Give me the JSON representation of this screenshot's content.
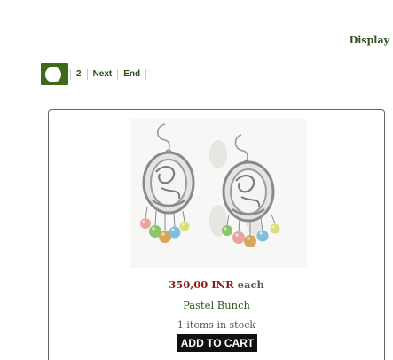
{
  "header": {
    "display_label": "Display"
  },
  "pagination": {
    "current_page_icon": "current-page-circle-icon",
    "pages": [
      "2"
    ],
    "next_label": "Next",
    "end_label": "End"
  },
  "product": {
    "image_icon": "pastel-earrings-photo",
    "price": "350,00 INR",
    "price_suffix": "each",
    "name": "Pastel Bunch",
    "stock_text": "1 items in stock",
    "add_to_cart_label": "ADD TO CART"
  },
  "colors": {
    "accent_green": "#3d6a1c",
    "link_green": "#2a4f17",
    "price_red": "#8b1a1a",
    "button_black": "#111111"
  }
}
